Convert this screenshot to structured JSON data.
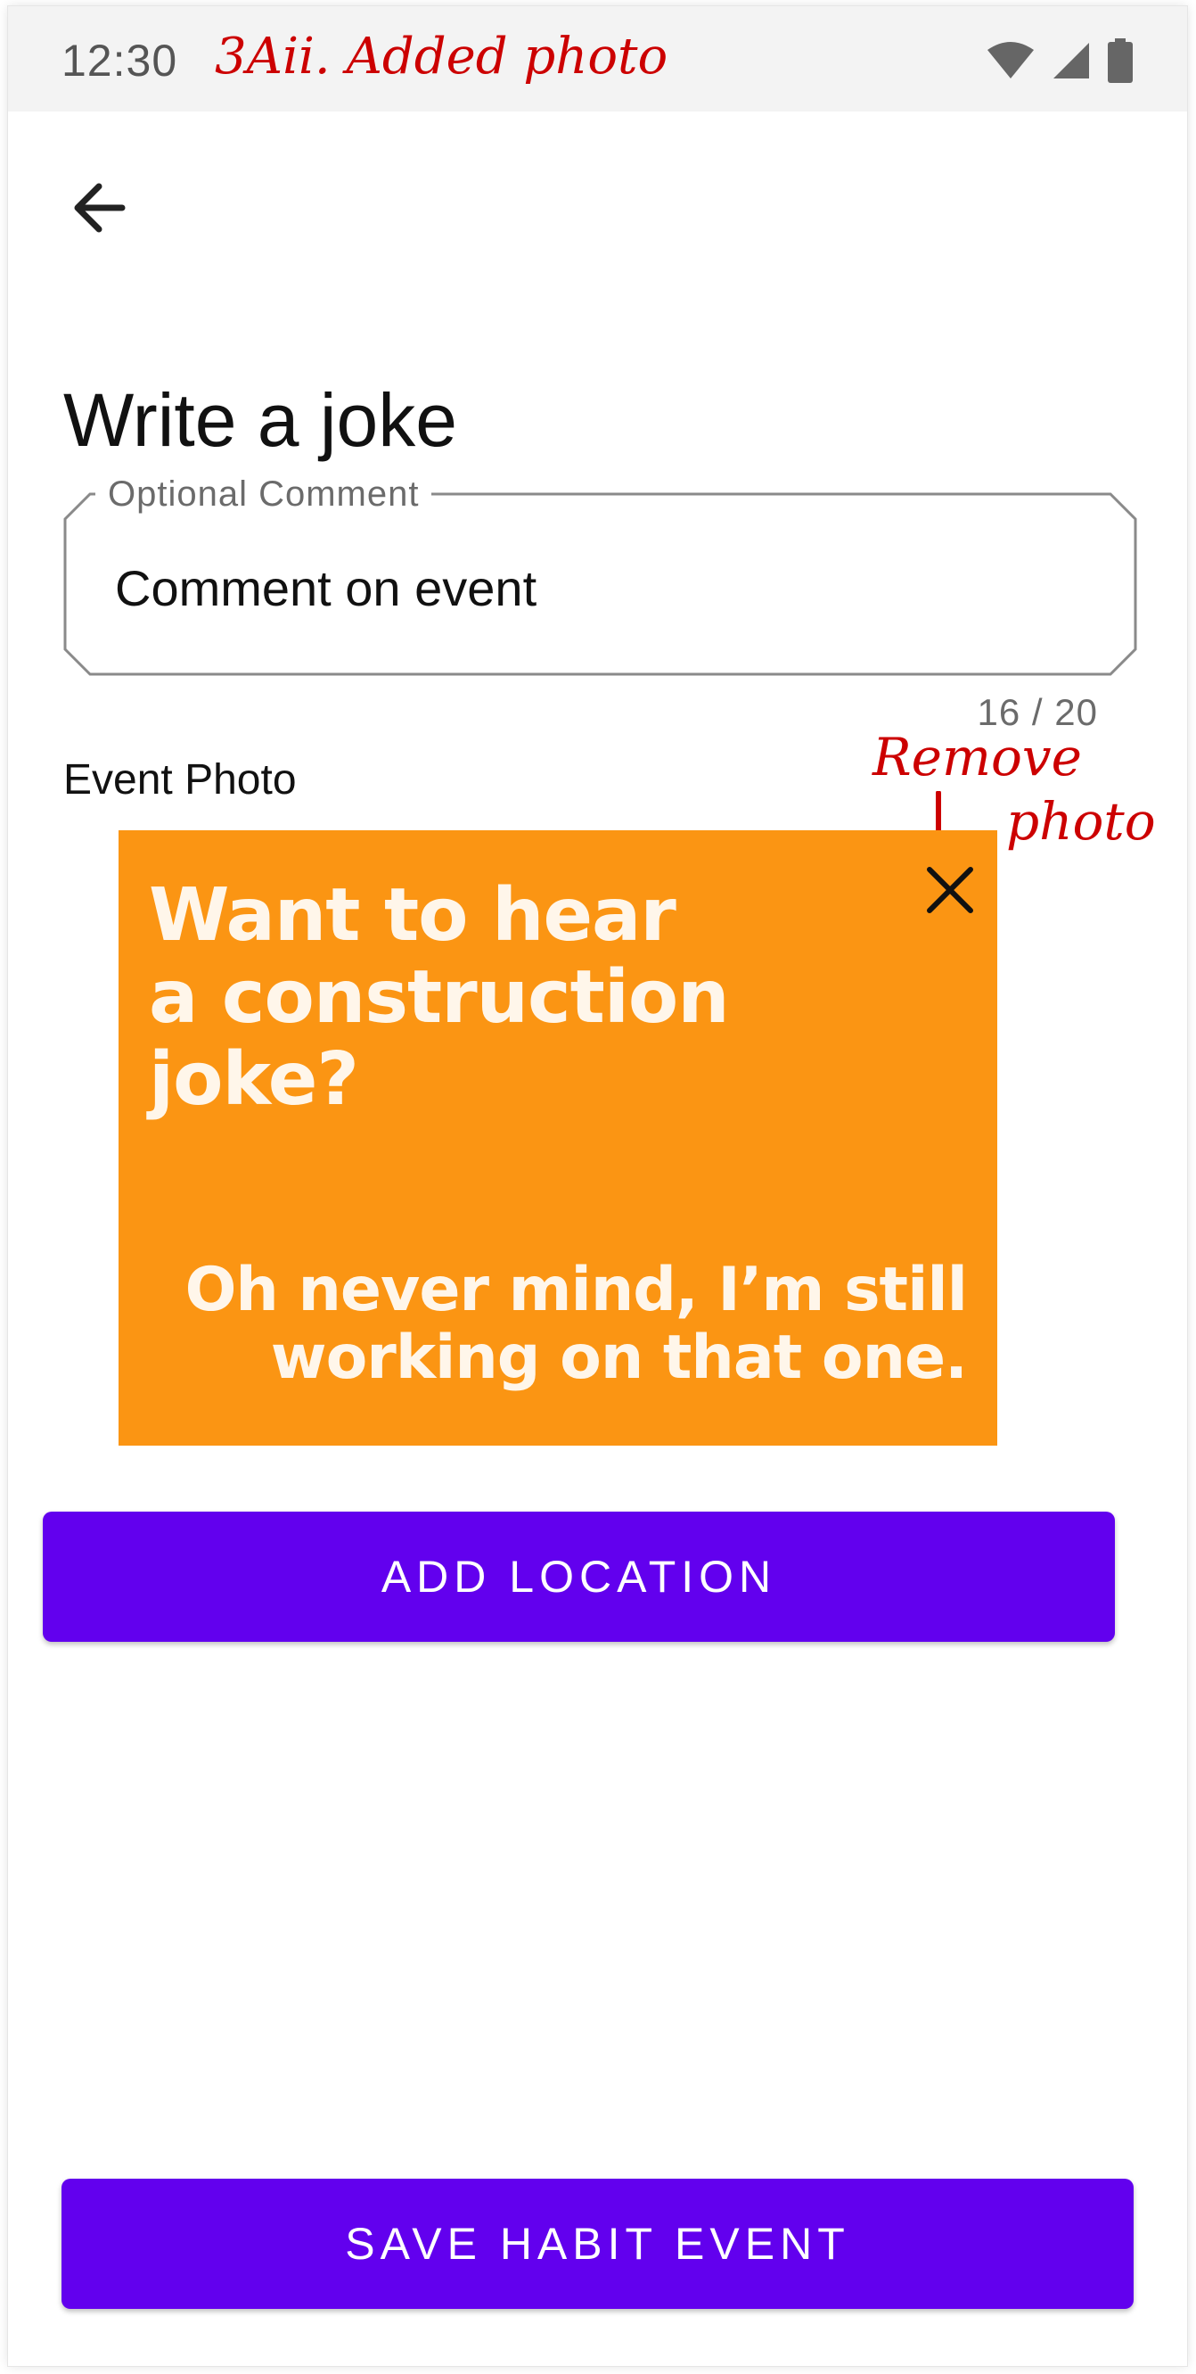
{
  "status_bar": {
    "time": "12:30",
    "icons": [
      "wifi-icon",
      "signal-icon",
      "battery-icon"
    ]
  },
  "annotations": {
    "title": "3Aii. Added photo",
    "remove_line1": "Remove",
    "remove_line2": "photo"
  },
  "page": {
    "title": "Write a joke"
  },
  "comment_field": {
    "label": "Optional Comment",
    "value": "Comment on event",
    "counter": "16 / 20"
  },
  "photo_section": {
    "label": "Event Photo",
    "photo_text_headline": "Want to hear\na construction\njoke?",
    "photo_text_punchline": "Oh never mind, I’m still\nworking on that one.",
    "background_color": "#fb9513"
  },
  "buttons": {
    "add_location": "ADD LOCATION",
    "save": "SAVE HABIT EVENT"
  },
  "colors": {
    "primary": "#6200ee",
    "annotation": "#cc0000"
  }
}
